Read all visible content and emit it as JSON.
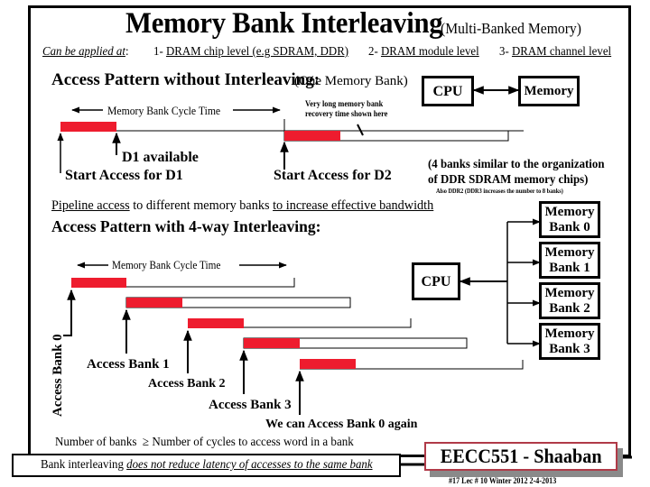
{
  "slide": {
    "title": "Memory Bank Interleaving",
    "subtitle": "(Multi-Banked Memory)",
    "applied_intro": "Can be applied at",
    "applied_colon": ":",
    "applied_items": [
      {
        "num": "1-",
        "text": "DRAM chip level (e.g  SDRAM, DDR)"
      },
      {
        "num": "2-",
        "text": "DRAM module level"
      },
      {
        "num": "3-",
        "text": "DRAM channel level"
      }
    ]
  },
  "no_interleave": {
    "heading": "Access Pattern without Interleaving:",
    "heading_note": "(One Memory Bank)",
    "cycle_time_label": "Memory Bank Cycle Time",
    "recovery_note_line1": "Very long memory bank",
    "recovery_note_line2": "recovery time shown here",
    "d1_available": "D1 available",
    "start_d1": "Start Access for D1",
    "start_d2": "Start Access for D2",
    "cpu_label": "CPU",
    "memory_label": "Memory"
  },
  "banks_note": {
    "line1": "(4 banks similar to the organization",
    "line2": "of DDR SDRAM memory chips)",
    "line3": "Also DDR2 (DDR3 increases the number to 8 banks)"
  },
  "pipeline": {
    "part1": "Pipeline access",
    "part2": " to different memory banks ",
    "part3": "to increase effective bandwidth"
  },
  "interleave": {
    "heading": "Access Pattern with 4-way Interleaving:",
    "cycle_time_label": "Memory Bank Cycle Time",
    "access_bank_0": "Access Bank 0",
    "access_bank_1": "Access Bank 1",
    "access_bank_2": "Access Bank 2",
    "access_bank_3": "Access Bank 3",
    "access_again": "We can Access Bank 0 again",
    "cpu_label": "CPU",
    "banks": [
      {
        "line1": "Memory",
        "line2": "Bank 0"
      },
      {
        "line1": "Memory",
        "line2": "Bank 1"
      },
      {
        "line1": "Memory",
        "line2": "Bank 2"
      },
      {
        "line1": "Memory",
        "line2": "Bank 3"
      }
    ]
  },
  "rule": {
    "left": "Number of banks",
    "symbol": "≥",
    "right": "Number of cycles to access word in a bank"
  },
  "latency": {
    "prefix": "Bank interleaving ",
    "emphasis": "does not reduce latency of accesses to the same bank"
  },
  "badge": {
    "text": "EECC551 - Shaaban"
  },
  "footer": {
    "text": "#17   Lec # 10 Winter 2012  2-4-2013"
  },
  "colors": {
    "access_bar": "#ee1c2e",
    "badge_border": "#b03a48",
    "badge_shadow": "#8a8a8a"
  }
}
